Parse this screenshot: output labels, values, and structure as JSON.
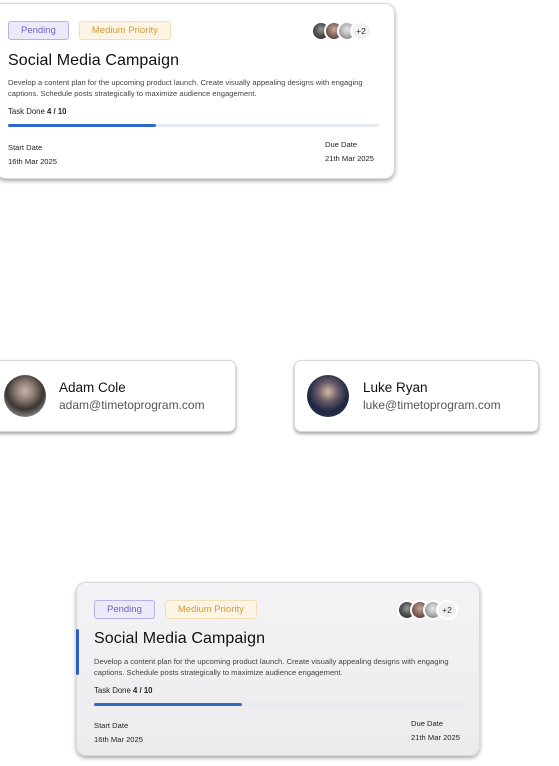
{
  "card_top": {
    "status": "Pending",
    "priority": "Medium Priority",
    "assignees_more": "+2",
    "title": "Social Media Campaign",
    "description": "Develop a content plan for the upcoming product launch. Create visually appealing designs with engaging captions. Schedule posts strategically to maximize audience engagement.",
    "tasks_label": "Task Done",
    "tasks_value": "4 / 10",
    "progress_fraction": 0.4,
    "start_label": "Start Date",
    "start_value": "16th Mar 2025",
    "due_label": "Due Date",
    "due_value": "21th Mar 2025"
  },
  "users": [
    {
      "name": "Adam Cole",
      "email": "adam@timetoprogram.com"
    },
    {
      "name": "Luke Ryan",
      "email": "luke@timetoprogram.com"
    }
  ],
  "card_bottom": {
    "status": "Pending",
    "priority": "Medium Priority",
    "assignees_more": "+2",
    "title": "Social Media Campaign",
    "description": "Develop a content plan for the upcoming product launch. Create visually appealing designs with engaging captions. Schedule posts strategically to maximize audience engagement.",
    "tasks_label": "Task Done",
    "tasks_value": "4 / 10",
    "progress_fraction": 0.4,
    "start_label": "Start Date",
    "start_value": "16th Mar 2025",
    "due_label": "Due Date",
    "due_value": "21th Mar 2025"
  },
  "colors": {
    "status_text": "#6b63c9",
    "priority_text": "#d49a3b",
    "progress_fill": "#2f6ac9"
  }
}
